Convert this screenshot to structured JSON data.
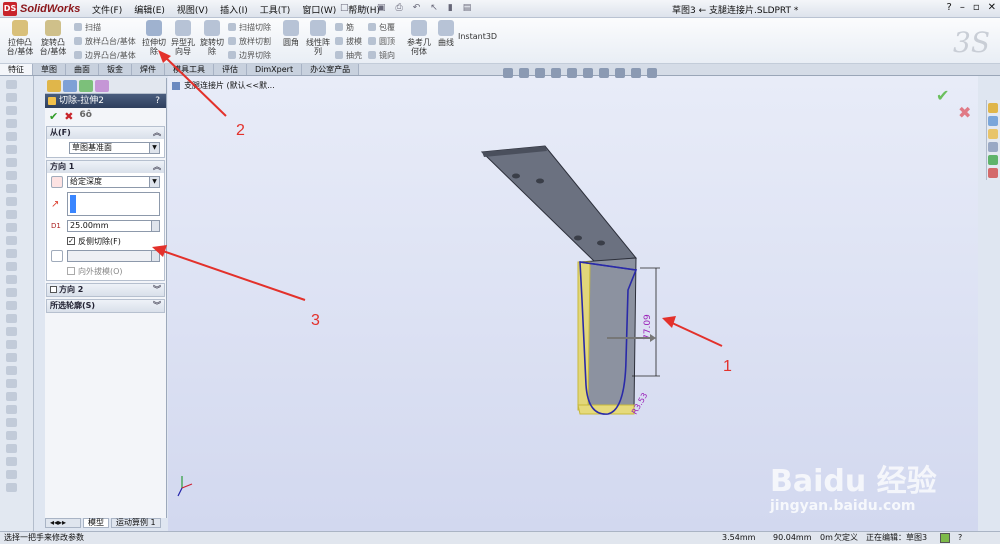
{
  "app": {
    "name": "SolidWorks",
    "title": "草图3 ← 支腿连接片.SLDPRT *"
  },
  "menu": [
    "文件(F)",
    "编辑(E)",
    "视图(V)",
    "插入(I)",
    "工具(T)",
    "窗口(W)",
    "帮助(H)"
  ],
  "ribbon": {
    "extrude_boss": "拉伸凸\n台/基体",
    "revolve_boss": "旋转凸\n台/基体",
    "sweep": "扫描",
    "loft": "放样凸台/基体",
    "boundary": "边界凸台/基体",
    "extrude_cut": "拉伸切\n除",
    "hole_wizard": "异型孔\n向导",
    "revolve_cut": "旋转切\n除",
    "swept_cut": "扫描切除",
    "lofted_cut": "放样切割",
    "boundary_cut": "边界切除",
    "fillet": "圆角",
    "linear_pattern": "线性阵\n列",
    "rib": "筋",
    "draft": "拔模",
    "shell": "抽壳",
    "wrap": "包覆",
    "dome": "圆顶",
    "mirror": "镜向",
    "ref_geometry": "参考几\n何体",
    "curves": "曲线",
    "instant3d": "Instant3D"
  },
  "tabs": [
    "特征",
    "草图",
    "曲面",
    "钣金",
    "焊件",
    "模具工具",
    "评估",
    "DimXpert",
    "办公室产品"
  ],
  "tree_path": "支腿连接片 (默认<<默...",
  "property_manager": {
    "title": "切除-拉伸2",
    "help": "?",
    "from": {
      "header": "从(F)",
      "value": "草图基准面"
    },
    "direction1": {
      "header": "方向 1",
      "end_condition": "给定深度",
      "depth": "25.00mm",
      "flip_side_label": "反侧切除(F)",
      "flip_side_checked": true,
      "draft_label": "向外拔模(O)"
    },
    "direction2": {
      "header": "方向 2"
    },
    "selected_contours": {
      "header": "所选轮廓(S)"
    }
  },
  "bottom_tabs": [
    "模型",
    "运动算例 1"
  ],
  "dimensions": {
    "height": "77.09",
    "radius": "R3.53"
  },
  "annotations": [
    "1",
    "2",
    "3"
  ],
  "status": {
    "message": "选择一把手来修改参数",
    "x": "3.54mm",
    "y": "90.04mm",
    "z": "0m",
    "state": "欠定义",
    "editing": "正在编辑：草图3"
  },
  "watermark": {
    "brand": "Baidu 经验",
    "url": "jingyan.baidu.com"
  },
  "colors": {
    "accent": "#2e3f5d",
    "arrow": "#e3312b",
    "graphics_bg": "#dde2f3"
  }
}
